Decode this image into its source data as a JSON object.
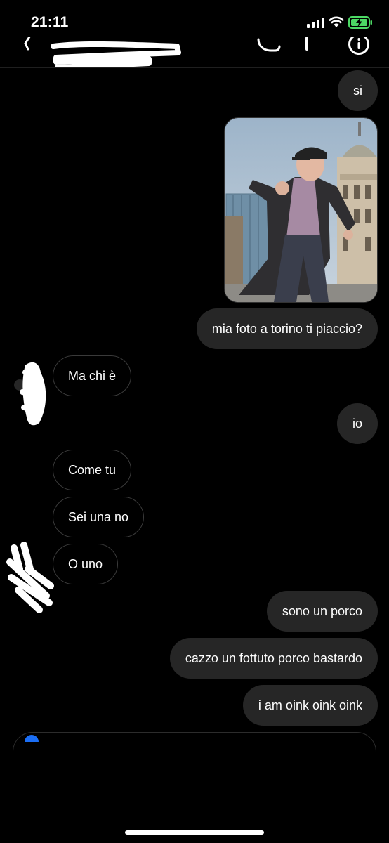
{
  "status_bar": {
    "time": "21:11"
  },
  "messages": [
    {
      "id": "m1",
      "side": "sent",
      "text": "si"
    },
    {
      "id": "m2",
      "side": "sent",
      "type": "photo"
    },
    {
      "id": "m3",
      "side": "sent",
      "text": "mia foto a torino ti piaccio?"
    },
    {
      "id": "m4",
      "side": "received",
      "text": "Ma chi è"
    },
    {
      "id": "m5",
      "side": "sent",
      "text": "io"
    },
    {
      "id": "m6",
      "side": "received",
      "text": "Come tu"
    },
    {
      "id": "m7",
      "side": "received",
      "text": "Sei una no"
    },
    {
      "id": "m8",
      "side": "received",
      "text": "O uno"
    },
    {
      "id": "m9",
      "side": "sent",
      "text": "sono un porco"
    },
    {
      "id": "m10",
      "side": "sent",
      "text": "cazzo un fottuto porco bastardo"
    },
    {
      "id": "m11",
      "side": "sent",
      "text": "i am oink oink oink"
    }
  ],
  "colors": {
    "background": "#000000",
    "sent_bubble": "#262626",
    "received_border": "#3a3a3a",
    "battery_charging": "#4cd964"
  },
  "icons": [
    "signal-icon",
    "wifi-icon",
    "battery-charging-icon",
    "back-icon",
    "call-icon",
    "video-call-icon",
    "info-icon"
  ]
}
